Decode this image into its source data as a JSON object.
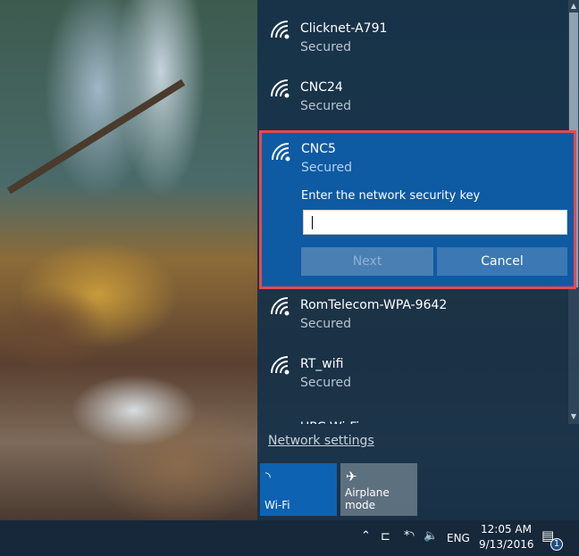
{
  "networks": [
    {
      "name": "Clicknet-A791",
      "status": "Secured"
    },
    {
      "name": "CNC24",
      "status": "Secured"
    },
    {
      "name": "CNC5",
      "status": "Secured"
    },
    {
      "name": "RomTelecom-WPA-9642",
      "status": "Secured"
    },
    {
      "name": "RT_wifi",
      "status": "Secured"
    },
    {
      "name": "UPC Wi-Fi",
      "status": ""
    }
  ],
  "selected": {
    "key_label": "Enter the network security key",
    "key_value": "",
    "next": "Next",
    "cancel": "Cancel"
  },
  "network_settings": "Network settings",
  "tiles": [
    {
      "label": "Wi-Fi",
      "icon": "wifi-icon",
      "active": true
    },
    {
      "label": "Airplane mode",
      "icon": "airplane-icon",
      "active": false
    }
  ],
  "taskbar": {
    "language": "ENG",
    "time": "12:05 AM",
    "date": "9/13/2016",
    "notifications": "1"
  },
  "colors": {
    "accent": "#0e5aa3",
    "highlight_border": "#e14b4f"
  }
}
